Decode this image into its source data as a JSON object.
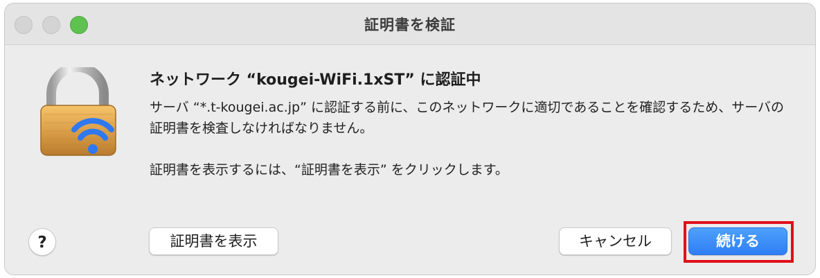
{
  "window": {
    "title": "証明書を検証"
  },
  "dialog": {
    "heading": "ネットワーク “kougei-WiFi.1xST” に認証中",
    "message_1": "サーバ “*.t-kougei.ac.jp” に認証する前に、このネットワークに適切であることを確認するため、サーバの証明書を検査しなければなりません。",
    "message_2": "証明書を表示するには、“証明書を表示” をクリックします。",
    "icon": "wifi-lock-icon"
  },
  "buttons": {
    "help_label": "?",
    "show_certificate_label": "証明書を表示",
    "cancel_label": "キャンセル",
    "continue_label": "続ける"
  },
  "colors": {
    "accent_button": "#2f7ef5",
    "highlight_outline": "#e0101b",
    "zoom_light": "#5fc150"
  }
}
